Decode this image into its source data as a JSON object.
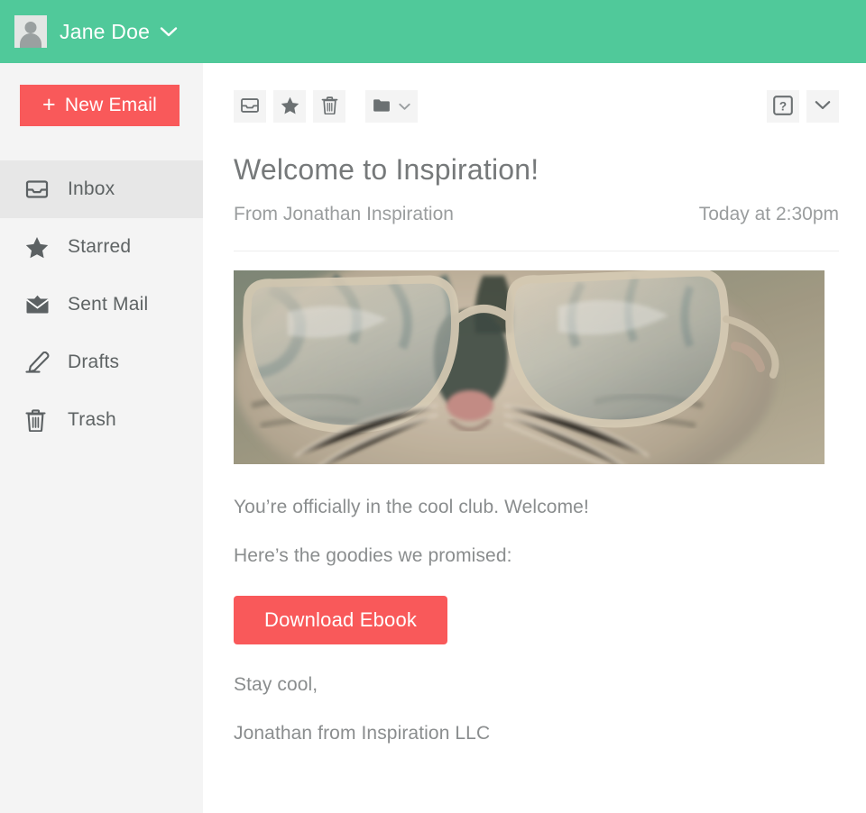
{
  "topbar": {
    "user_name": "Jane Doe",
    "avatar_name": "user-avatar",
    "caret_icon": "chevron-down-icon",
    "background_color": "#50c99a"
  },
  "sidebar": {
    "compose_button": {
      "label": "New Email",
      "plus": "+",
      "color": "#f9595a"
    },
    "items": [
      {
        "label": "Inbox",
        "icon": "inbox-icon",
        "active": true
      },
      {
        "label": "Starred",
        "icon": "star-icon",
        "active": false
      },
      {
        "label": "Sent Mail",
        "icon": "sent-mail-icon",
        "active": false
      },
      {
        "label": "Drafts",
        "icon": "pencil-icon",
        "active": false
      },
      {
        "label": "Trash",
        "icon": "trash-icon",
        "active": false
      }
    ]
  },
  "toolbar": {
    "left_buttons": [
      {
        "name": "archive-button",
        "icon": "inbox-icon"
      },
      {
        "name": "star-button",
        "icon": "star-icon"
      },
      {
        "name": "delete-button",
        "icon": "trash-icon"
      },
      {
        "name": "move-to-folder-button",
        "icon": "folder-icon"
      }
    ],
    "right_buttons": [
      {
        "name": "help-button",
        "icon": "question-mark-icon"
      },
      {
        "name": "more-options-button",
        "icon": "chevron-down-icon"
      }
    ]
  },
  "email": {
    "subject": "Welcome to Inspiration!",
    "sender": "From Jonathan Inspiration",
    "timestamp": "Today at 2:30pm",
    "hero_image_alt": "cat wearing large glasses",
    "body": {
      "line1": "You’re officially in the cool club. Welcome!",
      "line2": "Here’s the goodies we promised:",
      "cta_label": "Download Ebook",
      "signoff": "Stay cool,",
      "signature": "Jonathan from Inspiration LLC"
    }
  }
}
